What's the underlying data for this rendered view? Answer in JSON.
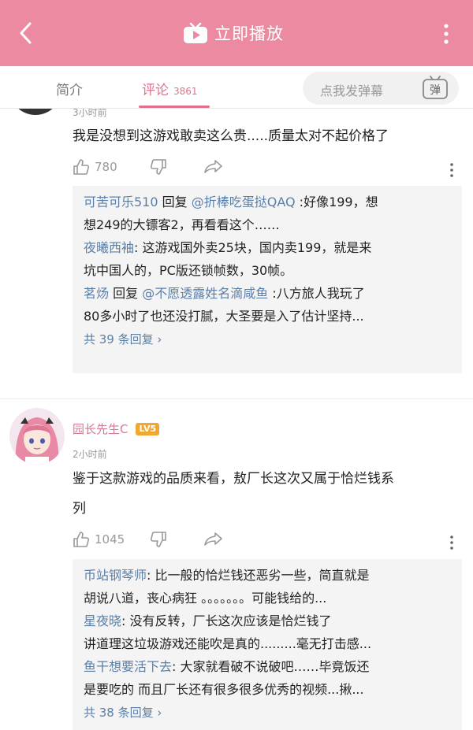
{
  "header": {
    "back_icon": "chevron-left-icon",
    "play_icon": "tv-play-icon",
    "title": "立即播放",
    "more_icon": "vertical-dots-icon",
    "color": "#eb8aa0"
  },
  "tabs": [
    {
      "label": "简介"
    },
    {
      "label": "评论",
      "count": "3861"
    }
  ],
  "danmaku": {
    "placeholder": "点我发弹幕",
    "button_label": "弹"
  },
  "comments": [
    {
      "time": "3小时前",
      "text": "我是没想到这游戏敢卖这么贵.....质量太对不起价格了",
      "likes": "780",
      "replies": [
        {
          "user": "可苦可乐510",
          "line1": " 回复 ",
          "mention": "@折棒吃蛋挞QAQ",
          "line1_rest": " :好像199，想",
          "line2": "想249的大镖客2，再看看这个……"
        },
        {
          "user": "夜曦西袖",
          "line1_rest": ": 这游戏国外卖25块，国内卖199，就是来",
          "line2": "坑中国人的，PC版还锁帧数，30帧。"
        },
        {
          "user": "茗炀",
          "line1": " 回复 ",
          "mention": "@不愿透露姓名滴咸鱼",
          "line1_rest": " :八方旅人我玩了",
          "line2": "80多小时了也还没打腻，大圣要是入了估计坚持..."
        }
      ],
      "more_replies": "共 39 条回复 ›"
    },
    {
      "author": "园长先生C",
      "level": "LV5",
      "time": "2小时前",
      "text_line1": "鉴于这款游戏的品质来看，敖厂长这次又属于恰烂钱系",
      "text_line2": "列",
      "likes": "1045",
      "replies": [
        {
          "user": "币站钢琴师",
          "line1_rest": ": 比一般的恰烂钱还恶劣一些，简直就是",
          "line2": "胡说八道，丧心病狂 。。。。。。。可能钱给的..."
        },
        {
          "user": "星夜晓",
          "line1_rest": ": 没有反转，厂长这次应该是恰烂钱了",
          "line2": "讲道理这垃圾游戏还能吹是真的.........毫无打击感..."
        },
        {
          "user": "鱼干想要活下去",
          "line1_rest": ": 大家就看破不说破吧……毕竟饭还",
          "line2": "是要吃的 而且厂长还有很多很多优秀的视频...揪..."
        }
      ],
      "more_replies": "共 38 条回复 ›"
    }
  ]
}
